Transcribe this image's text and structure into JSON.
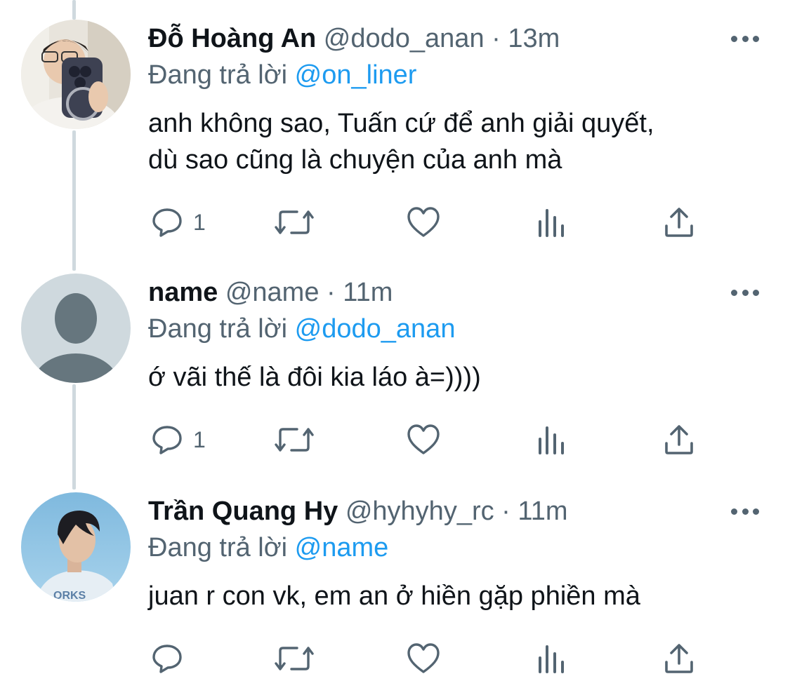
{
  "tweets": [
    {
      "display_name": "Đỗ Hoàng An",
      "handle": "@dodo_anan",
      "separator": "·",
      "time": "13m",
      "reply_prefix": "Đang trả lời",
      "reply_to": "@on_liner",
      "text_lines": [
        "anh không sao, Tuấn cứ để anh giải quyết,",
        "dù sao cũng là chuyện của anh mà"
      ],
      "reply_count": "1",
      "avatar": "photo-person-holding-phone"
    },
    {
      "display_name": "name",
      "handle": "@name",
      "separator": "·",
      "time": "11m",
      "reply_prefix": "Đang trả lời",
      "reply_to": "@dodo_anan",
      "text_lines": [
        "ớ vãi thế là đôi kia láo à=))))"
      ],
      "reply_count": "1",
      "avatar": "default-avatar"
    },
    {
      "display_name": "Trần Quang Hy",
      "handle": "@hyhyhy_rc",
      "separator": "·",
      "time": "11m",
      "reply_prefix": "Đang trả lời",
      "reply_to": "@name",
      "text_lines": [
        "juan r con vk, em an ở hiền gặp phiền mà"
      ],
      "reply_count": "",
      "avatar": "photo-person-sky"
    }
  ],
  "colors": {
    "text": "#0f1419",
    "secondary": "#536471",
    "link": "#1d9bf0",
    "thread_line": "#cfd9de"
  },
  "icons": [
    "reply-icon",
    "retweet-icon",
    "like-icon",
    "analytics-icon",
    "share-icon",
    "more-icon"
  ]
}
